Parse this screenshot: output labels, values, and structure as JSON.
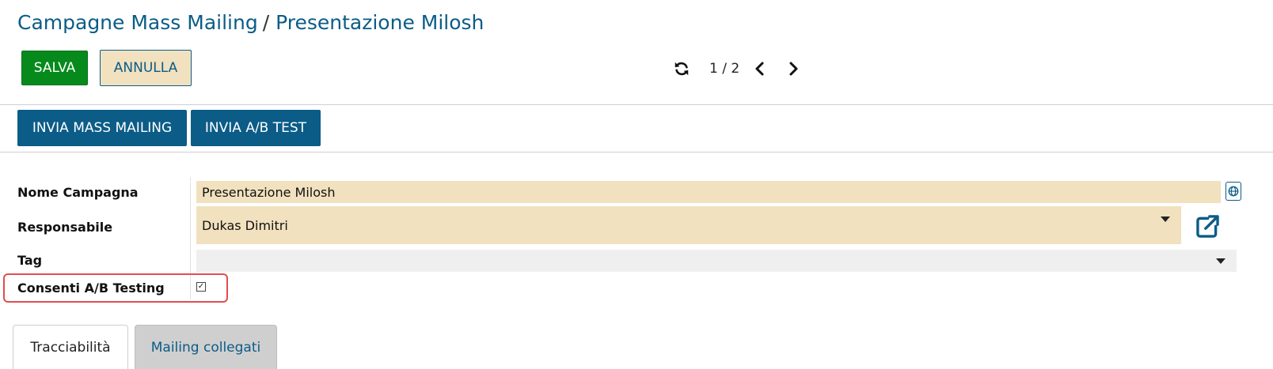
{
  "breadcrumb": {
    "parent": "Campagne Mass Mailing",
    "separator": "/",
    "current": "Presentazione Milosh"
  },
  "toolbar": {
    "save_label": "SALVA",
    "cancel_label": "ANNULLA"
  },
  "pager": {
    "value": "1 / 2",
    "icons": [
      "refresh-icon",
      "chevron-left-icon",
      "chevron-right-icon"
    ]
  },
  "actions": {
    "send_mass_mailing": "INVIA MASS MAILING",
    "send_ab_test": "INVIA A/B TEST"
  },
  "form": {
    "campaign_name": {
      "label": "Nome Campagna",
      "value": "Presentazione Milosh",
      "icon": "globe-icon"
    },
    "responsible": {
      "label": "Responsabile",
      "value": "Dukas Dimitri",
      "icon": "external-link-icon"
    },
    "tag": {
      "label": "Tag",
      "value": ""
    },
    "ab_testing": {
      "label": "Consenti A/B Testing",
      "checked": true
    }
  },
  "tabs": [
    {
      "label": "Tracciabilità",
      "active": true
    },
    {
      "label": "Mailing collegati",
      "active": false
    }
  ],
  "colors": {
    "primary": "#0b5c87",
    "save": "#068a1c",
    "field_bg": "#f1e1bf",
    "highlight": "#e04e4e"
  }
}
